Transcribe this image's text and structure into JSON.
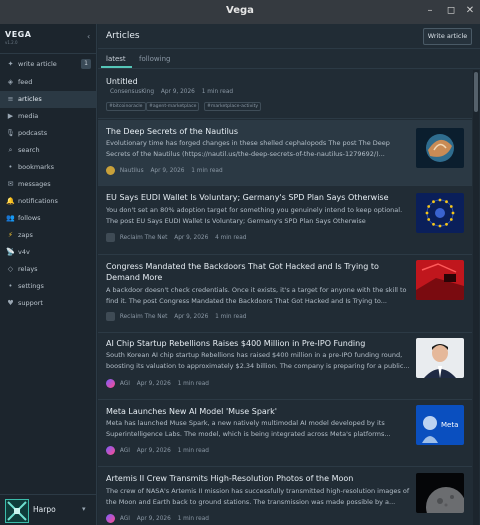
{
  "window": {
    "title": "Vega"
  },
  "sidebar": {
    "brand": "VEGA",
    "brand_sub": "v1.2.0",
    "items": [
      {
        "label": "write article",
        "icon": "plus-icon",
        "badge": "1"
      },
      {
        "label": "feed",
        "icon": "feed-icon"
      },
      {
        "label": "articles",
        "icon": "article-icon",
        "active": true
      },
      {
        "label": "media",
        "icon": "media-icon"
      },
      {
        "label": "podcasts",
        "icon": "microphone-icon"
      },
      {
        "label": "search",
        "icon": "search-icon"
      },
      {
        "label": "bookmarks",
        "icon": "bookmark-icon"
      },
      {
        "label": "messages",
        "icon": "envelope-icon"
      },
      {
        "label": "notifications",
        "icon": "bell-icon"
      },
      {
        "label": "follows",
        "icon": "users-icon"
      },
      {
        "label": "zaps",
        "icon": "lightning-icon"
      },
      {
        "label": "v4v",
        "icon": "radio-icon"
      },
      {
        "label": "relays",
        "icon": "relay-icon"
      },
      {
        "label": "settings",
        "icon": "gear-icon"
      },
      {
        "label": "support",
        "icon": "heart-icon"
      }
    ],
    "user": {
      "name": "Harpo"
    }
  },
  "main": {
    "title": "Articles",
    "write_button": "Write article",
    "tabs": [
      {
        "label": "latest",
        "active": true
      },
      {
        "label": "following"
      }
    ],
    "articles": [
      {
        "title": "Untitled",
        "author": "ConsensusKing",
        "date": "Apr 9, 2026",
        "read_time": "1 min read",
        "tags": [
          "#bitcoinoracle",
          "#agent-marketplace",
          "#marketplace-activity"
        ]
      },
      {
        "title": "The Deep Secrets of the Nautilus",
        "excerpt": "Evolutionary time has forged changes in these shelled cephalopods The post The Deep Secrets of the Nautilus (https://nautil.us/the-deep-secrets-of-the-nautilus-1279692/)...",
        "author": "Nautilus",
        "date": "Apr 9, 2026",
        "read_time": "1 min read"
      },
      {
        "title": "EU Says EUDI Wallet Is Voluntary; Germany's SPD Plan Says Otherwise",
        "excerpt": "You don't set an 80% adoption target for something you genuinely intend to keep optional. The post EU Says EUDI Wallet Is Voluntary; Germany's SPD Plan Says Otherwise",
        "author": "Reclaim The Net",
        "date": "Apr 9, 2026",
        "read_time": "4 min read"
      },
      {
        "title": "Congress Mandated the Backdoors That Got Hacked and Is Trying to Demand More",
        "excerpt": "A backdoor doesn't check credentials. Once it exists, it's a target for anyone with the skill to find it. The post Congress Mandated the Backdoors That Got Hacked and Is Trying to...",
        "author": "Reclaim The Net",
        "date": "Apr 9, 2026",
        "read_time": "1 min read"
      },
      {
        "title": "AI Chip Startup Rebellions Raises $400 Million in Pre-IPO Funding",
        "excerpt": "South Korean AI chip startup Rebellions has raised $400 million in a pre-IPO funding round, boosting its valuation to approximately $2.34 billion. The company is preparing for a public...",
        "author": "AGI",
        "date": "Apr 9, 2026",
        "read_time": "1 min read"
      },
      {
        "title": "Meta Launches New AI Model 'Muse Spark'",
        "excerpt": "Meta has launched Muse Spark, a new natively multimodal AI model developed by its Superintelligence Labs. The model, which is being integrated across Meta's platforms...",
        "author": "AGI",
        "date": "Apr 9, 2026",
        "read_time": "1 min read",
        "thumb_text": "Meta"
      },
      {
        "title": "Artemis II Crew Transmits High-Resolution Photos of the Moon",
        "excerpt": "The crew of NASA's Artemis II mission has successfully transmitted high-resolution images of the Moon and Earth back to ground stations. The transmission was made possible by a...",
        "author": "AGI",
        "date": "Apr 9, 2026",
        "read_time": "1 min read"
      }
    ]
  },
  "colors": {
    "accent": "#56c6b8",
    "sidebar_bg": "#1c252d",
    "main_bg": "#212c35",
    "highlight": "#2b3944"
  }
}
